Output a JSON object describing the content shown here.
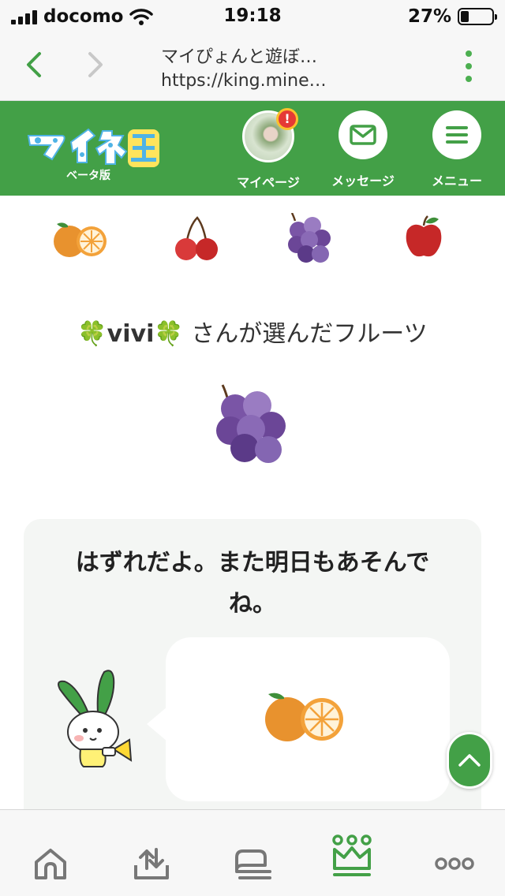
{
  "status_bar": {
    "carrier": "docomo",
    "time": "19:18",
    "battery_percent": "27%",
    "battery_level": 0.27,
    "icons": [
      "signal-icon",
      "wifi-icon",
      "battery-icon"
    ]
  },
  "browser": {
    "page_title": "マイぴょんと遊ぼ…",
    "url": "https://king.mine…",
    "icons": [
      "back-icon",
      "forward-icon",
      "more-vertical-icon"
    ],
    "accent": "#4caf50"
  },
  "header": {
    "logo_text": "マイネ王",
    "beta_label": "ベータ版",
    "mypage_label": "マイページ",
    "message_label": "メッセージ",
    "menu_label": "メニュー",
    "notification_badge": "!",
    "background": "#43a047"
  },
  "fruits": [
    "orange",
    "cherry",
    "grape",
    "apple"
  ],
  "chosen": {
    "nickname": "🍀vivi🍀",
    "suffix": " さんが選んだフルーツ",
    "fruit": "grape"
  },
  "result": {
    "message": "はずれだよ。また明日もあそんでね。",
    "mascot": "mascot-rabbit",
    "answer_fruit": "orange"
  },
  "tabbar": {
    "icons": [
      "home-icon",
      "upload-icon",
      "chat-icon",
      "crown-icon",
      "more-horizontal-icon"
    ],
    "active": "crown-icon"
  }
}
